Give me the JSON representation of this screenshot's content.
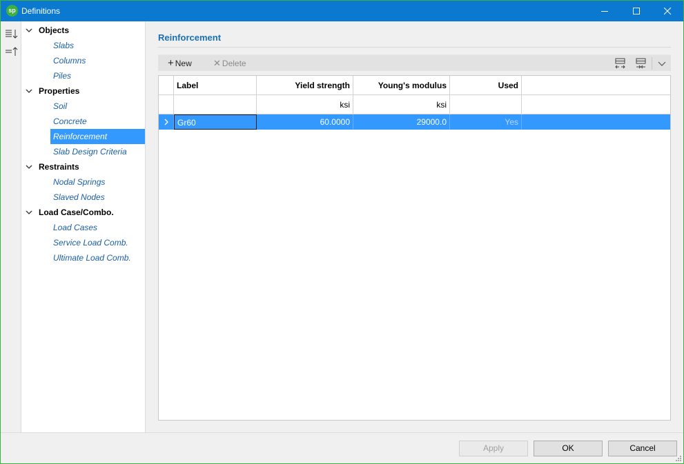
{
  "window": {
    "title": "Definitions",
    "app_badge": "sp"
  },
  "tree": {
    "groups": [
      {
        "label": "Objects",
        "items": [
          "Slabs",
          "Columns",
          "Piles"
        ]
      },
      {
        "label": "Properties",
        "items": [
          "Soil",
          "Concrete",
          "Reinforcement",
          "Slab Design Criteria"
        ]
      },
      {
        "label": "Restraints",
        "items": [
          "Nodal Springs",
          "Slaved Nodes"
        ]
      },
      {
        "label": "Load Case/Combo.",
        "items": [
          "Load Cases",
          "Service Load Comb.",
          "Ultimate Load Comb."
        ]
      }
    ],
    "selected": "Reinforcement"
  },
  "main": {
    "title": "Reinforcement",
    "toolbar": {
      "new_label": "New",
      "delete_label": "Delete"
    },
    "grid": {
      "columns": [
        "Label",
        "Yield strength",
        "Young's modulus",
        "Used"
      ],
      "units": [
        "",
        "ksi",
        "ksi",
        ""
      ],
      "rows": [
        {
          "label": "Gr60",
          "yield_strength": "60.0000",
          "youngs_modulus": "29000.0",
          "used": "Yes"
        }
      ]
    }
  },
  "buttons": {
    "apply": "Apply",
    "ok": "OK",
    "cancel": "Cancel"
  },
  "icons": {
    "close": "close-icon",
    "maximize": "maximize-icon",
    "minimize": "minimize-icon",
    "expand_all": "expand-all-icon",
    "collapse_all": "collapse-all-icon",
    "row_arrow": "chevron-right-icon"
  },
  "colors": {
    "titlebar": "#0b79d0",
    "selection": "#3399ff",
    "link": "#1a5ea8",
    "section_title": "#1a6fb0"
  }
}
